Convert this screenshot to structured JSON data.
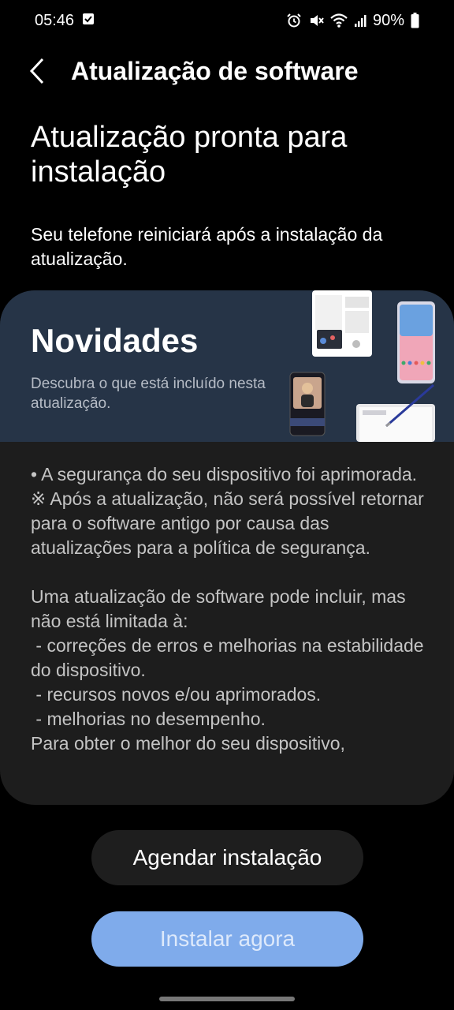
{
  "status_bar": {
    "time": "05:46",
    "battery": "90%",
    "icons": [
      "checkbox-notification-icon",
      "alarm-icon",
      "mute-icon",
      "wifi-icon",
      "signal-icon",
      "battery-icon"
    ]
  },
  "app_bar": {
    "title": "Atualização de software"
  },
  "headline": "Atualização pronta para instalação",
  "subtext": "Seu telefone reiniciará após a instalação da atualização.",
  "card": {
    "banner_title": "Novidades",
    "banner_subtitle": "Descubra o que está incluído nesta atualização.",
    "body_paragraphs": [
      "• A segurança do seu dispositivo foi aprimorada.",
      "※ Após a atualização, não será possível retornar para o software antigo por causa das atualizações para a política de segurança.",
      "",
      "Uma atualização de software pode incluir, mas não está limitada à:",
      " - correções de erros e melhorias na estabilidade do dispositivo.",
      " - recursos novos e/ou aprimorados.",
      " - melhorias no desempenho.",
      "Para obter o melhor do seu dispositivo,"
    ]
  },
  "buttons": {
    "schedule": "Agendar instalação",
    "install_now": "Instalar agora"
  },
  "colors": {
    "background": "#000000",
    "banner": "#263447",
    "card": "#1d1d1d",
    "install_button": "#7fabeb"
  }
}
